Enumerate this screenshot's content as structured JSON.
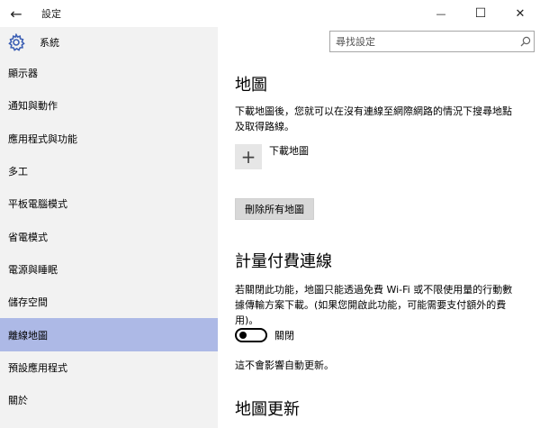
{
  "titlebar": {
    "title": "設定",
    "back_glyph": "←",
    "minimize_glyph": "—",
    "maximize_glyph": "☐",
    "close_glyph": "✕"
  },
  "sidebar": {
    "header_label": "系統",
    "items": [
      {
        "label": "顯示器"
      },
      {
        "label": "通知與動作"
      },
      {
        "label": "應用程式與功能"
      },
      {
        "label": "多工"
      },
      {
        "label": "平板電腦模式"
      },
      {
        "label": "省電模式"
      },
      {
        "label": "電源與睡眠"
      },
      {
        "label": "儲存空間"
      },
      {
        "label": "離線地圖",
        "selected": true
      },
      {
        "label": "預設應用程式"
      },
      {
        "label": "關於"
      }
    ]
  },
  "search": {
    "placeholder": "尋找設定"
  },
  "content": {
    "section_maps": {
      "title": "地圖",
      "description_line1": "下載地圖後，您就可以在沒有連線至網際網路的情況下搜尋地點",
      "description_line2": "及取得路線。",
      "download_label": "下載地圖",
      "plus_glyph": "+",
      "delete_all_label": "刪除所有地圖"
    },
    "section_metered": {
      "title": "計量付費連線",
      "description_line1": "若關閉此功能，地圖只能透過免費 Wi-Fi 或不限使用量的行動數",
      "description_line2": "據傳輸方案下載。(如果您開啟此功能，可能需要支付額外的費",
      "description_line3": "用)。",
      "toggle_state_label": "關閉",
      "note": "這不會影響自動更新。"
    },
    "section_updates": {
      "title": "地圖更新"
    }
  },
  "colors": {
    "sidebar_bg": "#f2f2f2",
    "selected_item_bg": "#adb9e6",
    "accent": "#3c5fb4"
  }
}
